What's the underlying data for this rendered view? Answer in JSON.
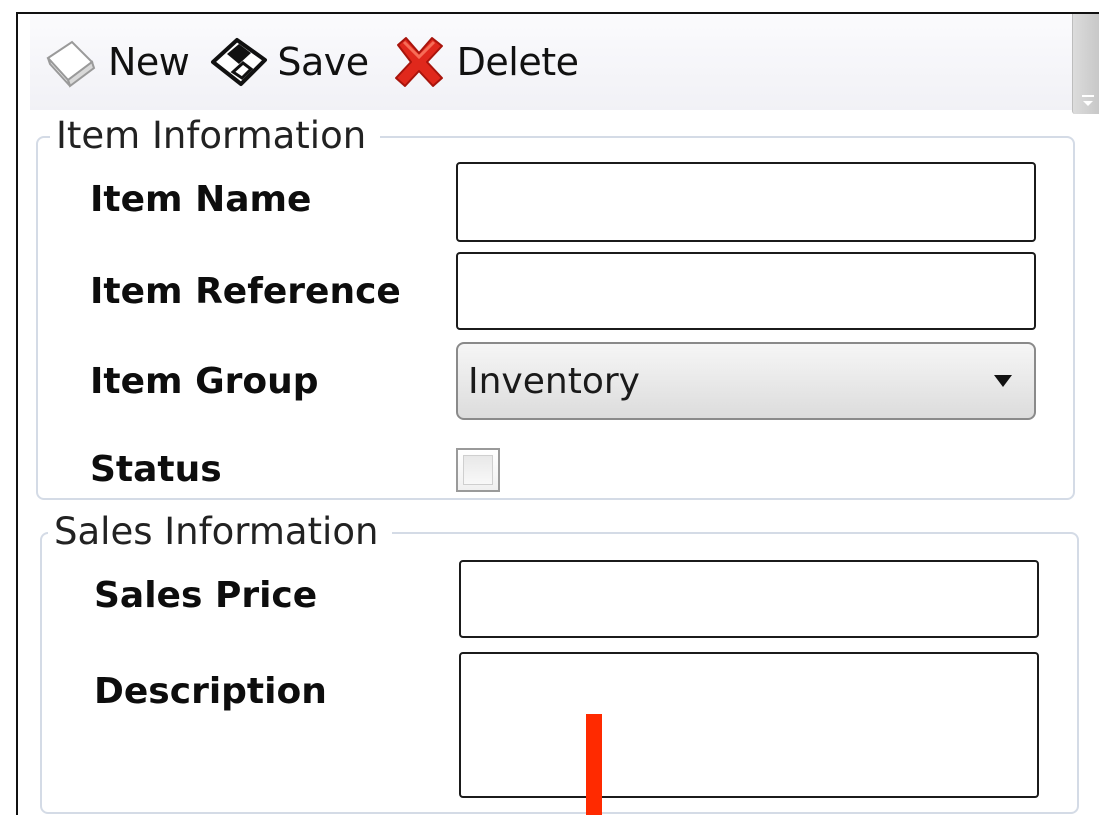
{
  "toolbar": {
    "new_label": "New",
    "save_label": "Save",
    "delete_label": "Delete",
    "icons": {
      "new": "new-document-icon",
      "save": "floppy-disk-icon",
      "delete": "red-x-delete-icon"
    }
  },
  "item_information": {
    "legend": "Item Information",
    "item_name_label": "Item Name",
    "item_name_value": "",
    "item_reference_label": "Item Reference",
    "item_reference_value": "",
    "item_group_label": "Item Group",
    "item_group_value": "Inventory",
    "status_label": "Status",
    "status_checked": false
  },
  "sales_information": {
    "legend": "Sales Information",
    "sales_price_label": "Sales Price",
    "sales_price_value": "",
    "description_label": "Description",
    "description_value": ""
  },
  "colors": {
    "delete_icon": "#e0281c",
    "group_border": "#d4dbe6",
    "cursor": "#ff2a00"
  }
}
